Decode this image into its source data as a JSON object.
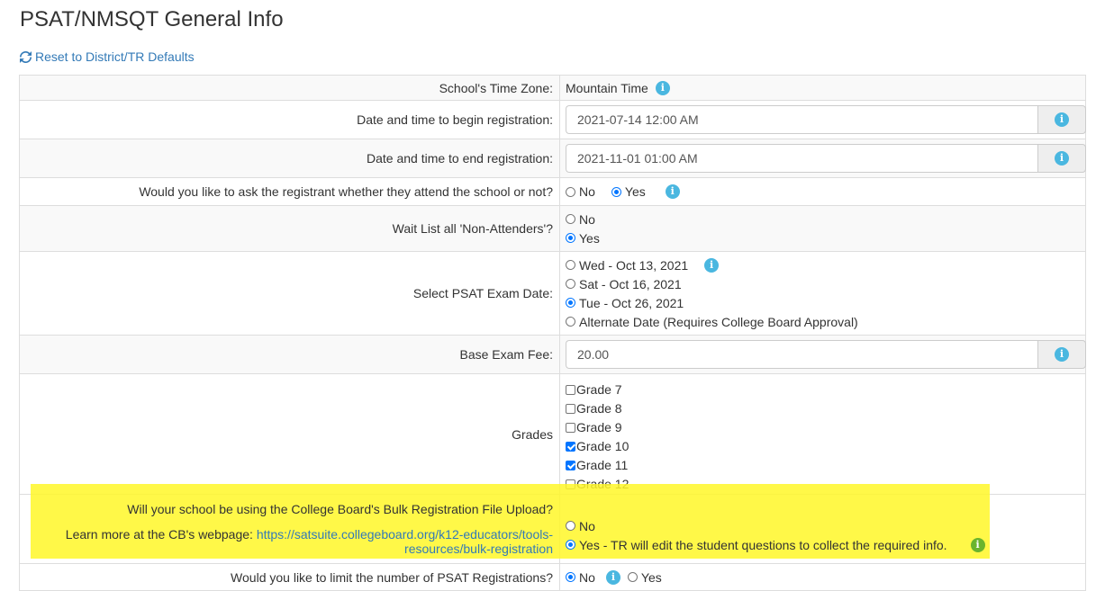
{
  "page": {
    "title": "PSAT/NMSQT General Info"
  },
  "reset": {
    "label": "Reset to District/TR Defaults"
  },
  "rows": {
    "timezone": {
      "label": "School's Time Zone:",
      "value": "Mountain Time"
    },
    "reg_begin": {
      "label": "Date and time to begin registration:",
      "value": "2021-07-14 12:00 AM"
    },
    "reg_end": {
      "label": "Date and time to end registration:",
      "value": "2021-11-01 01:00 AM"
    },
    "attend": {
      "label": "Would you like to ask the registrant whether they attend the school or not?",
      "options": [
        "No",
        "Yes"
      ],
      "selected": "Yes"
    },
    "waitlist": {
      "label": "Wait List all 'Non-Attenders'?",
      "options": [
        "No",
        "Yes"
      ],
      "selected": "Yes"
    },
    "exam_date": {
      "label": "Select PSAT Exam Date:",
      "options": [
        "Wed - Oct 13, 2021",
        "Sat - Oct 16, 2021",
        "Tue - Oct 26, 2021",
        "Alternate Date (Requires College Board Approval)"
      ],
      "selected": "Tue - Oct 26, 2021"
    },
    "fee": {
      "label": "Base Exam Fee:",
      "value": "20.00"
    },
    "grades": {
      "label": "Grades",
      "options": [
        "Grade 7",
        "Grade 8",
        "Grade 9",
        "Grade 10",
        "Grade 11",
        "Grade 12"
      ],
      "checked": [
        "Grade 10",
        "Grade 11"
      ]
    },
    "bulk": {
      "label": "Will your school be using the College Board's Bulk Registration File Upload?",
      "learn_prefix": "Learn more at the CB's webpage:",
      "link_line1": "https://satsuite.collegeboard.org/k12-educators/tools-",
      "link_line2": "resources/bulk-registration",
      "options": [
        "No",
        "Yes - TR will edit the student questions to collect the required info."
      ],
      "selected": "Yes - TR will edit the student questions to collect the required info."
    },
    "limit": {
      "label": "Would you like to limit the number of PSAT Registrations?",
      "options": [
        "No",
        "Yes"
      ],
      "selected": "No"
    }
  },
  "colors": {
    "info": "#4ab7e0",
    "info_green": "#6ab42d",
    "link": "#337ab7",
    "highlight": "#fff728"
  }
}
